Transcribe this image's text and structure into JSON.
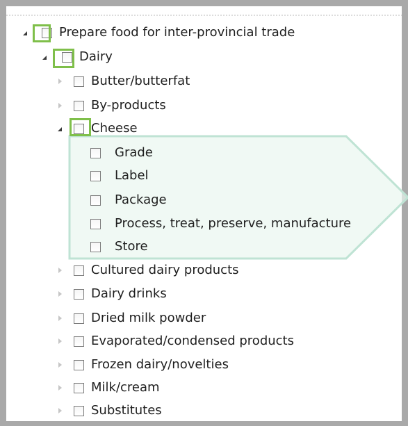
{
  "colors": {
    "highlight_box": "#7fbf4a",
    "callout_outline": "#bfe3d4",
    "callout_fill": "#eaf6ef",
    "frame_border": "#a9a9a9"
  },
  "icons": {
    "expanded": "expanded-triangle-icon",
    "collapsed": "collapsed-triangle-icon"
  },
  "tree": {
    "root": {
      "label": "Prepare food for inter-provincial trade",
      "state": "expanded"
    },
    "dairy": {
      "label": "Dairy",
      "state": "expanded"
    },
    "dairy_children": [
      {
        "label": "Butter/butterfat",
        "state": "collapsed"
      },
      {
        "label": "By-products",
        "state": "collapsed"
      },
      {
        "label": "Cheese",
        "state": "expanded"
      },
      {
        "label": "Cultured dairy products",
        "state": "collapsed"
      },
      {
        "label": "Dairy drinks",
        "state": "collapsed"
      },
      {
        "label": "Dried milk powder",
        "state": "collapsed"
      },
      {
        "label": "Evaporated/condensed products",
        "state": "collapsed"
      },
      {
        "label": "Frozen dairy/novelties",
        "state": "collapsed"
      },
      {
        "label": "Milk/cream",
        "state": "collapsed"
      },
      {
        "label": "Substitutes",
        "state": "collapsed"
      }
    ],
    "cheese_children": [
      {
        "label": "Grade"
      },
      {
        "label": "Label"
      },
      {
        "label": "Package"
      },
      {
        "label": "Process, treat, preserve, manufacture"
      },
      {
        "label": "Store"
      }
    ]
  }
}
